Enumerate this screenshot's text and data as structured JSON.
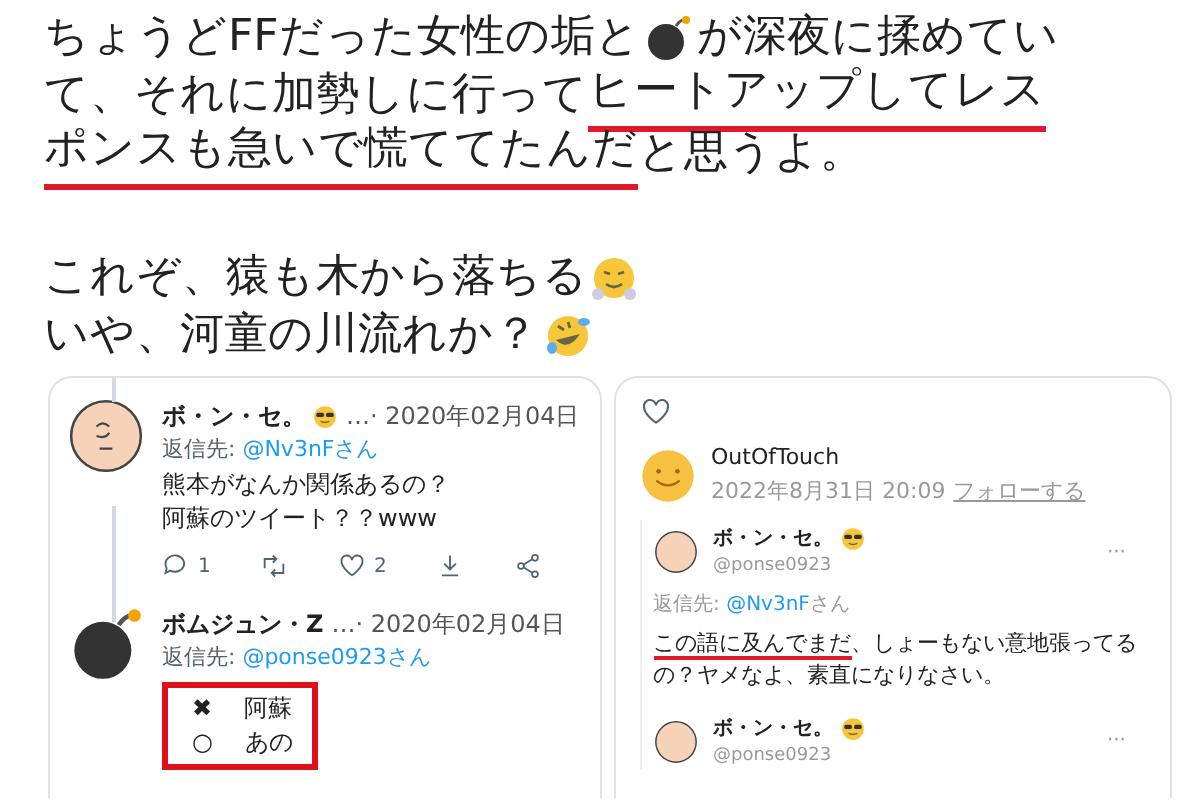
{
  "tweet": {
    "lines": [
      {
        "gap_before": false,
        "segments": [
          {
            "kind": "text",
            "text": "ちょうどFFだった女性の垢と",
            "underlined": false
          },
          {
            "kind": "bomb"
          },
          {
            "kind": "text",
            "text": "が深夜に揉めてい",
            "underlined": false
          }
        ]
      },
      {
        "gap_before": false,
        "segments": [
          {
            "kind": "text",
            "text": "て、それに加勢しに行って",
            "underlined": false
          },
          {
            "kind": "text",
            "text": "ヒートアップしてレス",
            "underlined": true
          }
        ]
      },
      {
        "gap_before": false,
        "segments": [
          {
            "kind": "text",
            "text": "ポンスも急いで慌ててたんだ",
            "underlined": true
          },
          {
            "kind": "text",
            "text": "と思うよ。",
            "underlined": false
          }
        ]
      },
      {
        "gap_before": true,
        "segments": [
          {
            "kind": "text",
            "text": "これぞ、猿も木から落ちる",
            "underlined": false
          },
          {
            "kind": "steam"
          }
        ]
      },
      {
        "gap_before": false,
        "segments": [
          {
            "kind": "text",
            "text": "いや、河童の川流れか？",
            "underlined": false
          },
          {
            "kind": "rofl"
          }
        ]
      }
    ]
  },
  "left_screenshot": {
    "tweets": [
      {
        "kind": "bald",
        "name": "ボ・ン・セ。",
        "sunglasses": true,
        "name_tail": "…",
        "date": "· 2020年02月04日",
        "reply_prefix": "返信先:",
        "reply_to": "@Nv3nFさん",
        "body": [
          "熊本がなんか関係あるの？",
          "阿蘇のツイート？？www"
        ],
        "actions": [
          {
            "kind": "reply",
            "count": "1"
          },
          {
            "kind": "retweet"
          },
          {
            "kind": "like",
            "count": "2"
          },
          {
            "kind": "download"
          },
          {
            "kind": "share"
          }
        ]
      },
      {
        "kind": "bomb",
        "name": "ボムジュン・Z",
        "sunglasses": false,
        "name_tail": "…",
        "date": "· 2020年02月04日",
        "reply_prefix": "返信先:",
        "reply_to": "@ponse0923さん",
        "options": [
          {
            "mark": "✖",
            "label": "阿蘇"
          },
          {
            "mark": "○",
            "label": "あの"
          }
        ]
      }
    ]
  },
  "right_screenshot": {
    "author": "OutOfTouch",
    "timestamp": "2022年8月31日 20:09",
    "follow": "フォローする",
    "embedded": [
      {
        "name": "ボ・ン・セ。",
        "handle": "@ponse0923",
        "more": "···",
        "reply_prefix": "返信先:",
        "reply_to": "@Nv3nF",
        "reply_suffix": "さん",
        "body": [
          {
            "text": "この語に及んでまだ",
            "underlined": true
          },
          {
            "text": "、しょーもない意地張ってるの？ヤメなよ、素直になりなさい。",
            "underlined": false
          }
        ]
      },
      {
        "name": "ボ・ン・セ。",
        "handle": "@ponse0923",
        "more": "···"
      }
    ]
  }
}
